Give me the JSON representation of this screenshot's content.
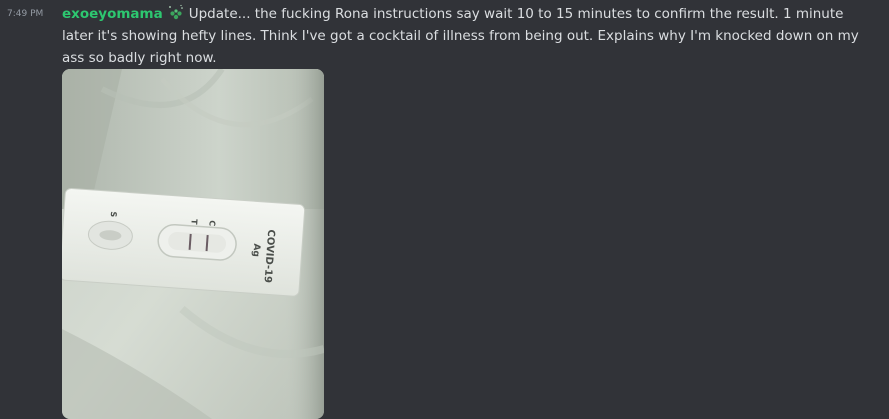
{
  "message": {
    "timestamp": "7:49 PM",
    "username": "exoeyomama",
    "role_icon": "sprout-icon",
    "text": "Update... the fucking Rona instructions say wait 10 to 15 minutes to confirm the result. 1 minute later it's showing hefty lines. Think I've got a cocktail of illness from being out. Explains why I'm knocked down on my ass so badly right now.",
    "username_color": "#2dc770",
    "text_color": "#dbdee1",
    "timestamp_color": "#949ba4",
    "background": "#313338"
  },
  "attachment": {
    "type": "photo",
    "test_labels": {
      "sample": "S",
      "control": "C",
      "test": "T",
      "brand_line1": "COVID-19",
      "brand_line2": "Ag"
    }
  }
}
